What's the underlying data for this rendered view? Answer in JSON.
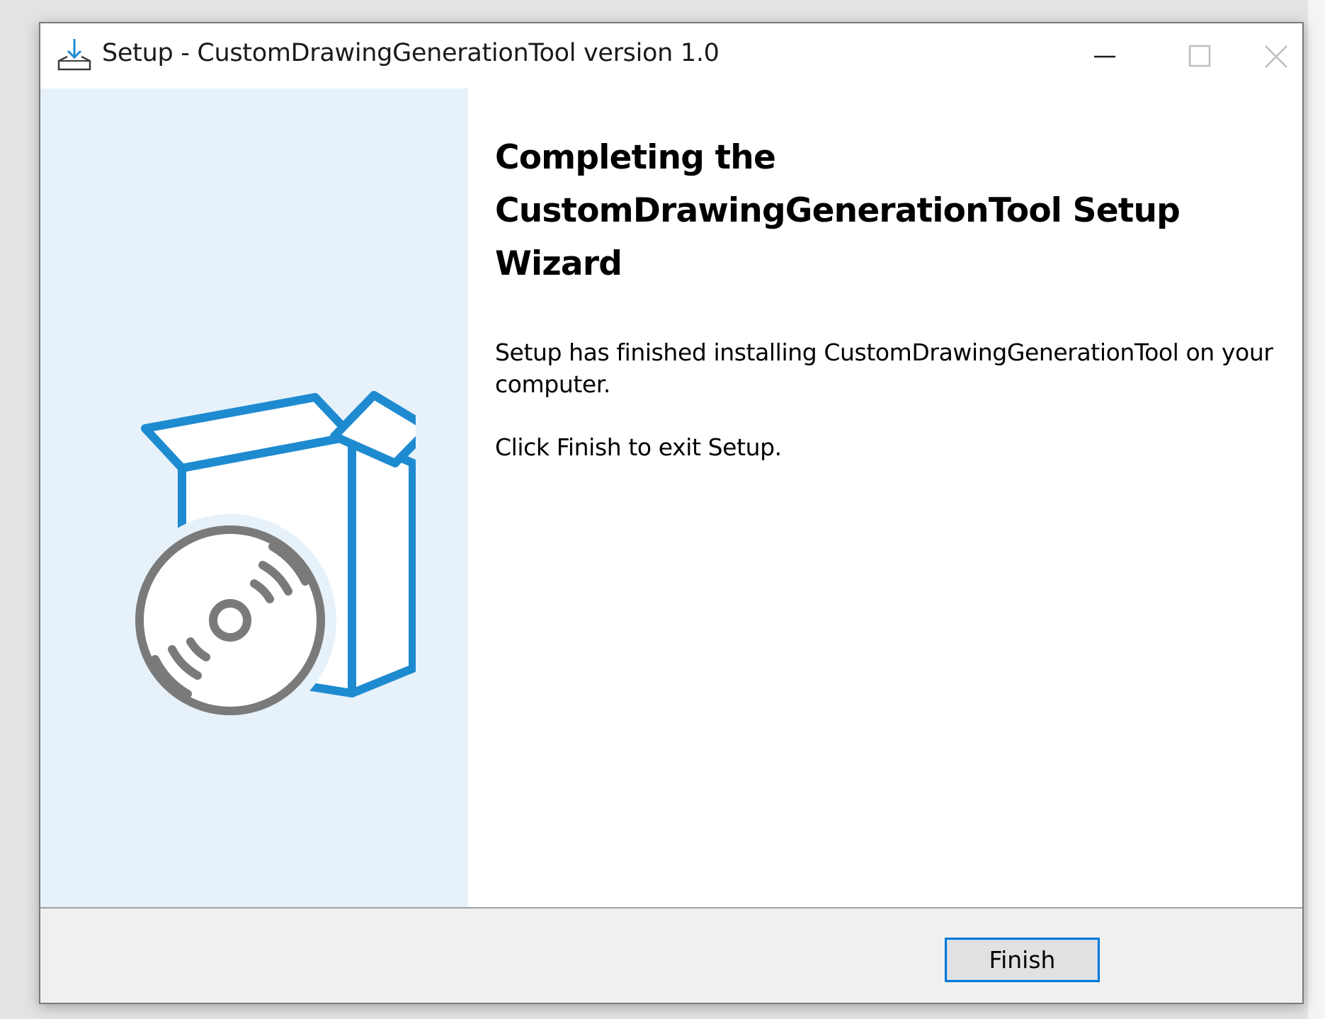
{
  "window": {
    "title": "Setup - CustomDrawingGenerationTool version 1.0"
  },
  "titlebar": {
    "icons": {
      "app": "setup-download-icon",
      "minimize": "minimize-icon",
      "maximize": "maximize-icon",
      "close": "close-icon"
    }
  },
  "sidebar": {
    "illustration": "software-box-with-disc-icon",
    "colors": {
      "background": "#e6f1f9",
      "box_outline": "#1e8bd0",
      "disc": "#7a7a7a"
    }
  },
  "main": {
    "heading": "Completing the CustomDrawingGenerationTool Setup Wizard",
    "finished_message": "Setup has finished installing CustomDrawingGenerationTool on your computer.",
    "exit_message": "Click Finish to exit Setup."
  },
  "footer": {
    "finish_label": "Finish",
    "accent": "#0078d7"
  }
}
